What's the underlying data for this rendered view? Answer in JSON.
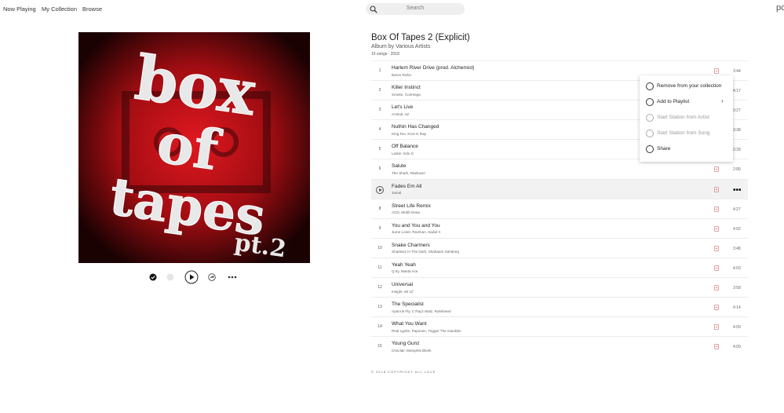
{
  "nav": {
    "now_playing": "Now Playing",
    "my_collection": "My Collection",
    "browse": "Browse",
    "corner": "pc"
  },
  "search": {
    "placeholder": "Search"
  },
  "album": {
    "title": "Box Of Tapes 2 (Explicit)",
    "subtitle": "Album by Various Artists",
    "meta": "15 songs · 2018",
    "cover_text": [
      "box",
      "of",
      "tapes",
      "pt.2"
    ]
  },
  "tracks": [
    {
      "num": "1",
      "title": "Harlem River Drive (prod. Alchemist)",
      "artist": "Baron Ricks",
      "duration": "3:44"
    },
    {
      "num": "2",
      "title": "Killer Instinct",
      "artist": "Smoke, Conrsega",
      "duration": "4:17"
    },
    {
      "num": "3",
      "title": "Let's Live",
      "artist": "Animal, AZ",
      "duration": "3:27"
    },
    {
      "num": "4",
      "title": "Nuthin Has Changed",
      "artist": "King Tee, Kool G Rap",
      "duration": "3:38"
    },
    {
      "num": "5",
      "title": "Off Balance",
      "artist": "Laster, Edo G",
      "duration": "3:39"
    },
    {
      "num": "6",
      "title": "Salute",
      "artist": "The Shark, Raekwon",
      "duration": "2:06"
    },
    {
      "num": "7",
      "title": "Fades Em All",
      "artist": "Jamal",
      "duration": ""
    },
    {
      "num": "8",
      "title": "Street Life Remix",
      "artist": "ACD, Mobb Deep",
      "duration": "4:27"
    },
    {
      "num": "9",
      "title": "You and You and You",
      "artist": "Jume Lover, Redman, Sadat X",
      "duration": "4:02"
    },
    {
      "num": "10",
      "title": "Snake Charmers",
      "artist": "Shadowz In The Dark, Shabaam Sahdeeq",
      "duration": "3:48"
    },
    {
      "num": "11",
      "title": "Yeah Yeah",
      "artist": "Q Ity, Masta Ace",
      "duration": "4:03"
    },
    {
      "num": "12",
      "title": "Universal",
      "artist": "Insight, Mr Lif",
      "duration": "3:58"
    },
    {
      "num": "13",
      "title": "The Specialist",
      "artist": "Apani B Fly, C Rayz Walz, Rahsheed",
      "duration": "4:14"
    },
    {
      "num": "14",
      "title": "What You Want",
      "artist": "Real Lyphe, Papoose, Trigger The Gambler",
      "duration": "4:09"
    },
    {
      "num": "15",
      "title": "Young Gunz",
      "artist": "Choclair, Memphis Bleek",
      "duration": "4:09"
    }
  ],
  "context_menu": {
    "items": [
      {
        "label": "Remove from your collection",
        "icon": "remove-icon",
        "disabled": false
      },
      {
        "label": "Add to Playlist",
        "icon": "add-playlist-icon",
        "disabled": false
      },
      {
        "label": "Start Station from Artist",
        "icon": "station-icon",
        "disabled": true
      },
      {
        "label": "Start Station from Song",
        "icon": "station-icon",
        "disabled": true
      },
      {
        "label": "Share",
        "icon": "share-icon",
        "disabled": false
      }
    ]
  },
  "footer": "© 2018 COPYRIGHT ALL LOVE",
  "colors": {
    "cover_red": "#c8161c",
    "accent": "#222222"
  }
}
